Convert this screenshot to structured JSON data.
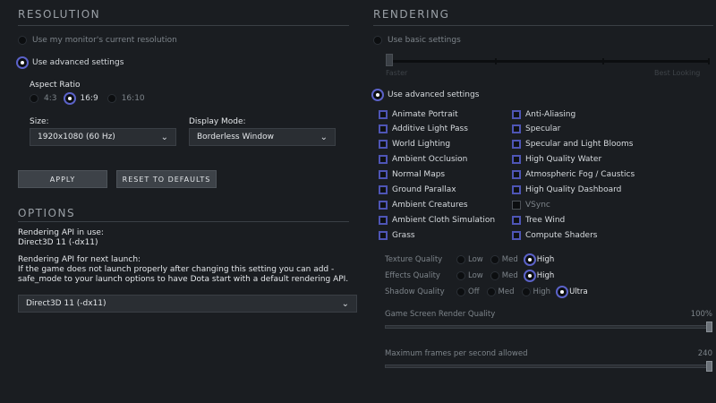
{
  "resolution": {
    "title": "RESOLUTION",
    "use_monitor": "Use my monitor's current resolution",
    "use_advanced": "Use advanced settings",
    "aspect_label": "Aspect Ratio",
    "aspect_options": [
      "4:3",
      "16:9",
      "16:10"
    ],
    "aspect_selected": "16:9",
    "size_label": "Size:",
    "size_value": "1920x1080 (60 Hz)",
    "display_mode_label": "Display Mode:",
    "display_mode_value": "Borderless Window",
    "apply": "APPLY",
    "reset": "RESET TO DEFAULTS"
  },
  "options": {
    "title": "OPTIONS",
    "api_in_use_label": "Rendering API in use:",
    "api_in_use_value": "Direct3D 11 (-dx11)",
    "api_next_label": "Rendering API for next launch:",
    "api_note": "If the game does not launch properly after changing this setting you can add -safe_mode to your launch options to have Dota start with a default rendering API.",
    "api_select_value": "Direct3D 11 (-dx11)"
  },
  "rendering": {
    "title": "RENDERING",
    "use_basic": "Use basic settings",
    "slider_left": "Faster",
    "slider_right": "Best Looking",
    "use_advanced": "Use advanced settings",
    "left_checks": [
      {
        "label": "Animate Portrait",
        "on": true
      },
      {
        "label": "Additive Light Pass",
        "on": true
      },
      {
        "label": "World Lighting",
        "on": true
      },
      {
        "label": "Ambient Occlusion",
        "on": true
      },
      {
        "label": "Normal Maps",
        "on": true
      },
      {
        "label": "Ground Parallax",
        "on": true
      },
      {
        "label": "Ambient Creatures",
        "on": true
      },
      {
        "label": "Ambient Cloth Simulation",
        "on": true
      },
      {
        "label": "Grass",
        "on": true
      }
    ],
    "right_checks": [
      {
        "label": "Anti-Aliasing",
        "on": true
      },
      {
        "label": "Specular",
        "on": true
      },
      {
        "label": "Specular and Light Blooms",
        "on": true
      },
      {
        "label": "High Quality Water",
        "on": true
      },
      {
        "label": "Atmospheric Fog / Caustics",
        "on": true
      },
      {
        "label": "High Quality Dashboard",
        "on": true
      },
      {
        "label": "VSync",
        "on": false
      },
      {
        "label": "Tree Wind",
        "on": true
      },
      {
        "label": "Compute Shaders",
        "on": true
      }
    ],
    "texture_label": "Texture Quality",
    "texture_options": [
      "Low",
      "Med",
      "High"
    ],
    "texture_selected": "High",
    "effects_label": "Effects Quality",
    "effects_options": [
      "Low",
      "Med",
      "High"
    ],
    "effects_selected": "High",
    "shadow_label": "Shadow Quality",
    "shadow_options": [
      "Off",
      "Med",
      "High",
      "Ultra"
    ],
    "shadow_selected": "Ultra",
    "render_quality_label": "Game Screen Render Quality",
    "render_quality_value": "100%",
    "render_quality_fraction": 1.0,
    "fps_label": "Maximum frames per second allowed",
    "fps_value": "240",
    "fps_fraction": 1.0
  },
  "colors": {
    "accent": "#5b62c8",
    "background": "#1a1d21"
  }
}
